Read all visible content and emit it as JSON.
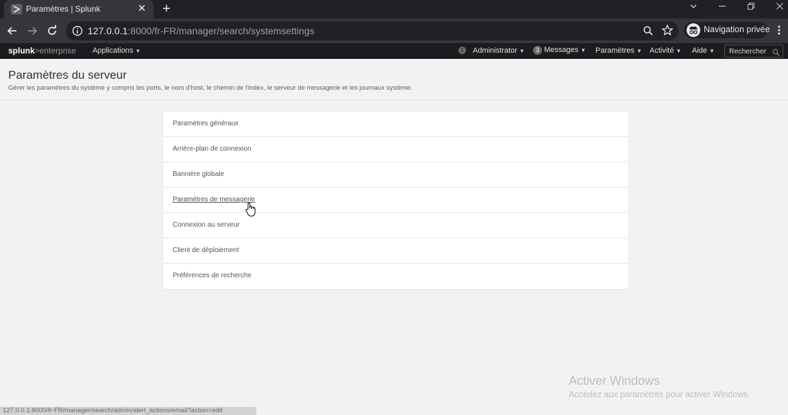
{
  "browser": {
    "tab_title": "Paramètres | Splunk",
    "tab_close": "✕",
    "new_tab": "+",
    "url_host": "127.0.0.1",
    "url_rest": ":8000/fr-FR/manager/search/systemsettings",
    "incognito_label": "Navigation privée",
    "status_url": "127.0.0.1:8000/fr-FR/manager/search/admin/alert_actions/email?action=edit"
  },
  "splunk": {
    "logo_bold": "splunk",
    "logo_rest": ">enterprise",
    "apps": "Applications",
    "admin": "Administrator",
    "messages_count": "3",
    "messages": "Messages",
    "settings": "Paramètres",
    "activity": "Activité",
    "help": "Aide",
    "search": "Rechercher"
  },
  "page": {
    "title": "Paramètres du serveur",
    "description": "Gérer les paramètres du système y compris les ports, le nom d'host, le chemin de l'index, le serveur de messagerie et les journaux système.",
    "items": [
      {
        "label": "Paramètres généraux"
      },
      {
        "label": "Arrière-plan de connexion"
      },
      {
        "label": "Bannière globale"
      },
      {
        "label": "Paramètres de messagerie"
      },
      {
        "label": "Connexion au serveur"
      },
      {
        "label": "Client de déploiement"
      },
      {
        "label": "Préférences de recherche"
      }
    ]
  },
  "watermark": {
    "title": "Activer Windows",
    "subtitle": "Accédez aux paramètres pour activer Windows."
  }
}
